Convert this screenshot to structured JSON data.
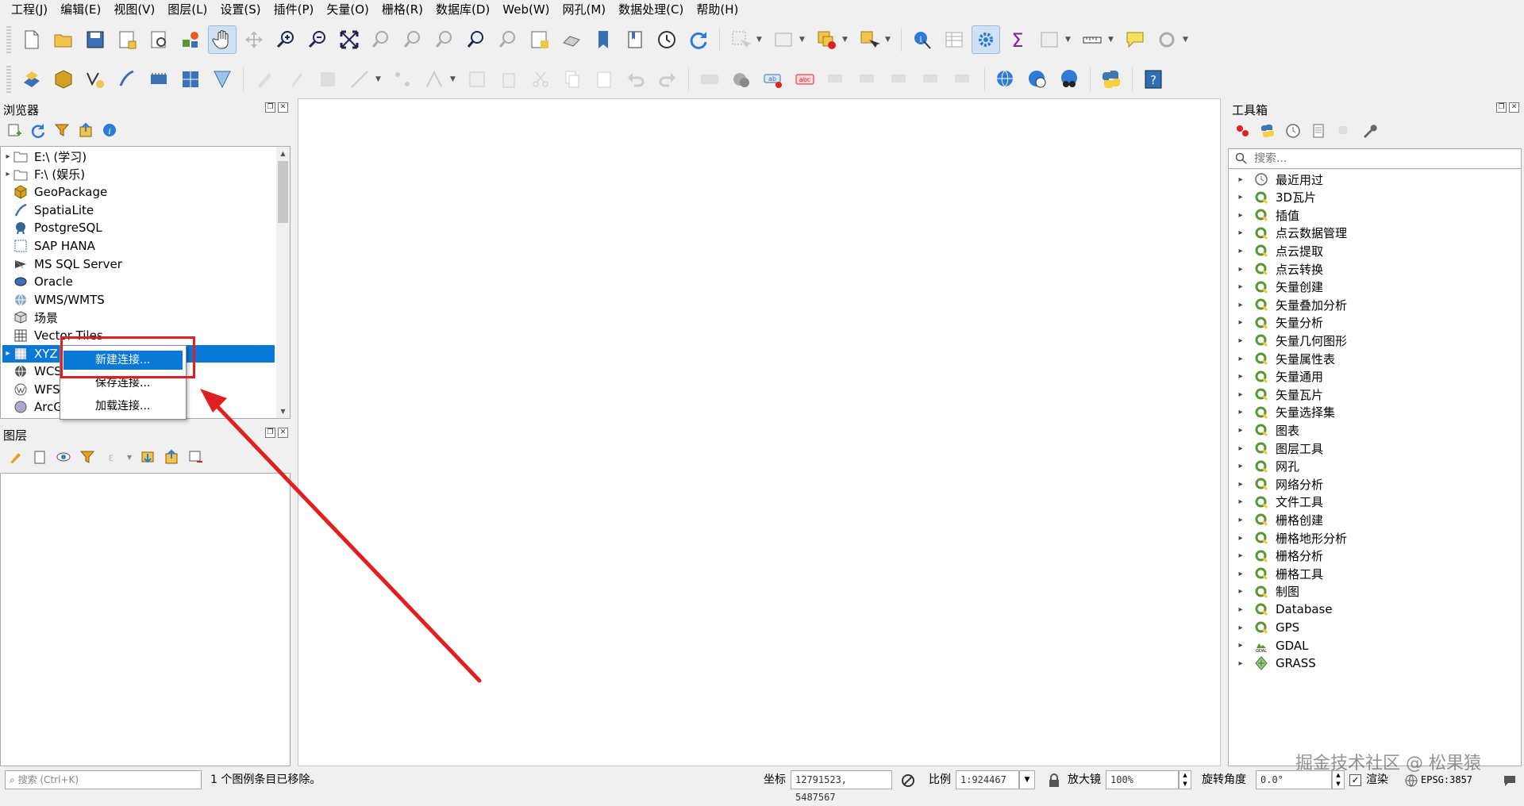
{
  "menu": [
    "工程(J)",
    "编辑(E)",
    "视图(V)",
    "图层(L)",
    "设置(S)",
    "插件(P)",
    "矢量(O)",
    "栅格(R)",
    "数据库(D)",
    "Web(W)",
    "网孔(M)",
    "数据处理(C)",
    "帮助(H)"
  ],
  "browser": {
    "title": "浏览器",
    "items": [
      {
        "label": "E:\\ (学习)",
        "icon": "folder-icon",
        "expand": true
      },
      {
        "label": "F:\\ (娱乐)",
        "icon": "folder-icon",
        "expand": true
      },
      {
        "label": "GeoPackage",
        "icon": "geopackage-icon",
        "expand": false
      },
      {
        "label": "SpatiaLite",
        "icon": "spatialite-icon",
        "expand": false
      },
      {
        "label": "PostgreSQL",
        "icon": "postgresql-icon",
        "expand": false
      },
      {
        "label": "SAP HANA",
        "icon": "sap-hana-icon",
        "expand": false
      },
      {
        "label": "MS SQL Server",
        "icon": "mssql-icon",
        "expand": false
      },
      {
        "label": "Oracle",
        "icon": "oracle-icon",
        "expand": false
      },
      {
        "label": "WMS/WMTS",
        "icon": "wms-icon",
        "expand": false
      },
      {
        "label": "场景",
        "icon": "scene-icon",
        "expand": false
      },
      {
        "label": "Vector Tiles",
        "icon": "vector-tiles-icon",
        "expand": false
      },
      {
        "label": "XYZ",
        "icon": "xyz-tiles-icon",
        "expand": true,
        "selected": true
      },
      {
        "label": "WCS",
        "icon": "wcs-icon",
        "expand": false
      },
      {
        "label": "WFS",
        "icon": "wfs-icon",
        "expand": false
      },
      {
        "label": "ArcG",
        "icon": "arcgis-icon",
        "expand": false
      }
    ]
  },
  "context_menu": {
    "items": [
      "新建连接...",
      "保存连接...",
      "加载连接..."
    ],
    "highlighted": 0
  },
  "layers": {
    "title": "图层"
  },
  "toolbox": {
    "title": "工具箱",
    "search_placeholder": "搜索...",
    "items": [
      {
        "label": "最近用过",
        "icon": "clock-icon"
      },
      {
        "label": "3D瓦片",
        "icon": "qgis-q-icon"
      },
      {
        "label": "插值",
        "icon": "qgis-q-icon"
      },
      {
        "label": "点云数据管理",
        "icon": "qgis-q-icon"
      },
      {
        "label": "点云提取",
        "icon": "qgis-q-icon"
      },
      {
        "label": "点云转换",
        "icon": "qgis-q-icon"
      },
      {
        "label": "矢量创建",
        "icon": "qgis-q-icon"
      },
      {
        "label": "矢量叠加分析",
        "icon": "qgis-q-icon"
      },
      {
        "label": "矢量分析",
        "icon": "qgis-q-icon"
      },
      {
        "label": "矢量几何图形",
        "icon": "qgis-q-icon"
      },
      {
        "label": "矢量属性表",
        "icon": "qgis-q-icon"
      },
      {
        "label": "矢量通用",
        "icon": "qgis-q-icon"
      },
      {
        "label": "矢量瓦片",
        "icon": "qgis-q-icon"
      },
      {
        "label": "矢量选择集",
        "icon": "qgis-q-icon"
      },
      {
        "label": "图表",
        "icon": "qgis-q-icon"
      },
      {
        "label": "图层工具",
        "icon": "qgis-q-icon"
      },
      {
        "label": "网孔",
        "icon": "qgis-q-icon"
      },
      {
        "label": "网络分析",
        "icon": "qgis-q-icon"
      },
      {
        "label": "文件工具",
        "icon": "qgis-q-icon"
      },
      {
        "label": "栅格创建",
        "icon": "qgis-q-icon"
      },
      {
        "label": "栅格地形分析",
        "icon": "qgis-q-icon"
      },
      {
        "label": "栅格分析",
        "icon": "qgis-q-icon"
      },
      {
        "label": "栅格工具",
        "icon": "qgis-q-icon"
      },
      {
        "label": "制图",
        "icon": "qgis-q-icon"
      },
      {
        "label": "Database",
        "icon": "qgis-q-icon"
      },
      {
        "label": "GPS",
        "icon": "qgis-q-icon"
      },
      {
        "label": "GDAL",
        "icon": "gdal-icon"
      },
      {
        "label": "GRASS",
        "icon": "grass-icon"
      }
    ]
  },
  "statusbar": {
    "search_placeholder": "搜索 (Ctrl+K)",
    "message": "1 个图例条目已移除。",
    "coord_label": "坐标",
    "coord_value": "12791523, 5487567",
    "scale_label": "比例",
    "scale_value": "1:924467",
    "magnifier_label": "放大镜",
    "magnifier_value": "100%",
    "rotation_label": "旋转角度",
    "rotation_value": "0.0°",
    "render_label": "渲染",
    "crs": "EPSG:3857"
  },
  "watermark": "掘金技术社区 @ 松果猿",
  "colors": {
    "selection": "#0a78d7",
    "annotation": "#e02020",
    "qgis_green": "#589632"
  }
}
